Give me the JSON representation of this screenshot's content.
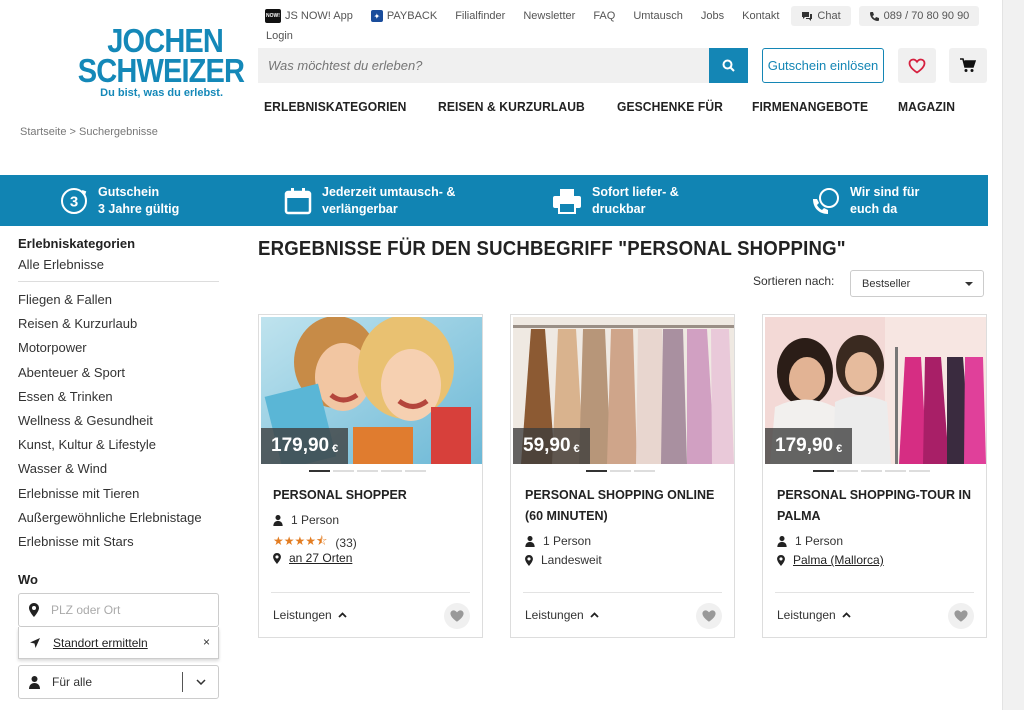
{
  "brand": {
    "line1": "JOCHEN",
    "line2": "SCHWEIZER",
    "tagline": "Du bist, was du erlebst."
  },
  "topbar": {
    "app_badge": "NOW!",
    "app": "JS NOW! App",
    "payback": "PAYBACK",
    "links": [
      "Filialfinder",
      "Newsletter",
      "FAQ",
      "Umtausch",
      "Jobs",
      "Kontakt"
    ],
    "chat": "Chat",
    "phone": "089 / 70 80 90 90",
    "login": "Login"
  },
  "search": {
    "placeholder": "Was möchtest du erleben?"
  },
  "header": {
    "voucher_btn": "Gutschein einlösen"
  },
  "mainnav": [
    "ERLEBNISKATEGORIEN",
    "REISEN & KURZURLAUB",
    "GESCHENKE FÜR",
    "FIRMENANGEBOTE",
    "MAGAZIN"
  ],
  "breadcrumb": "Startseite  >  Suchergebnisse",
  "usp": [
    {
      "l1": "Gutschein",
      "l2": "3 Jahre gültig",
      "icon": "three-circle-icon"
    },
    {
      "l1": "Jederzeit umtausch- &",
      "l2": "verlängerbar",
      "icon": "calendar-icon"
    },
    {
      "l1": "Sofort liefer- &",
      "l2": "druckbar",
      "icon": "printer-icon"
    },
    {
      "l1": "Wir sind für",
      "l2": "euch da",
      "icon": "phone-chat-icon"
    }
  ],
  "sidebar": {
    "heading": "Erlebniskategorien",
    "all": "Alle Erlebnisse",
    "categories": [
      "Fliegen & Fallen",
      "Reisen & Kurzurlaub",
      "Motorpower",
      "Abenteuer & Sport",
      "Essen & Trinken",
      "Wellness & Gesundheit",
      "Kunst, Kultur & Lifestyle",
      "Wasser & Wind",
      "Erlebnisse mit Tieren",
      "Außergewöhnliche Erlebnistage",
      "Erlebnisse mit Stars"
    ],
    "wo": "Wo",
    "plz_placeholder": "PLZ oder Ort",
    "locate": "Standort ermitteln",
    "locate_close": "×",
    "for_all": "Für alle"
  },
  "results": {
    "heading": "ERGEBNISSE FÜR DEN SUCHBEGRIFF \"PERSONAL SHOPPING\"",
    "sort_label": "Sortieren nach:",
    "sort_value": "Bestseller"
  },
  "cards": [
    {
      "title": "PERSONAL SHOPPER",
      "price": "179,90",
      "currency": "€",
      "persons": "1 Person",
      "rating_count": "(33)",
      "rating_stars": 4.5,
      "location": "an 27 Orten",
      "services": "Leistungen",
      "slides": 5,
      "active_slide": 0
    },
    {
      "title": "PERSONAL SHOPPING ONLINE (60 MINUTEN)",
      "price": "59,90",
      "currency": "€",
      "persons": "1 Person",
      "location": "Landesweit",
      "services": "Leistungen",
      "slides": 3,
      "active_slide": 0
    },
    {
      "title": "PERSONAL SHOPPING-TOUR IN PALMA",
      "price": "179,90",
      "currency": "€",
      "persons": "1 Person",
      "location": "Palma (Mallorca)",
      "services": "Leistungen",
      "slides": 5,
      "active_slide": 0
    }
  ]
}
